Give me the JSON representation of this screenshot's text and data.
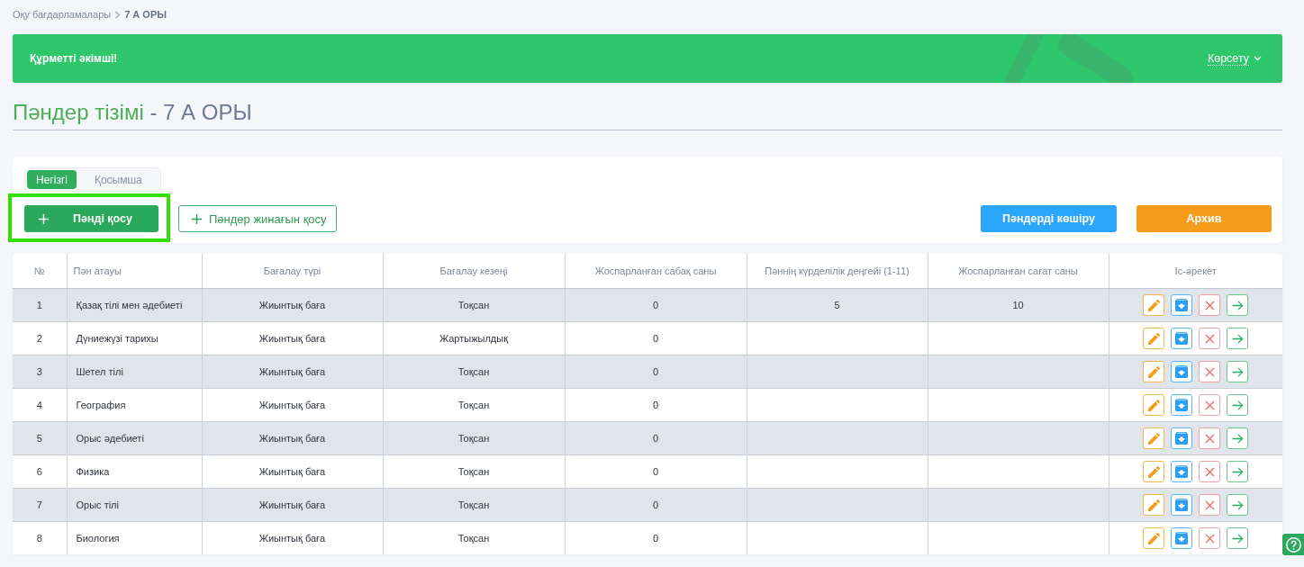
{
  "breadcrumb": [
    {
      "label": "Оқу бағдарламалары",
      "current": false
    },
    {
      "label": "7 А ОРЫ",
      "current": true
    }
  ],
  "banner": {
    "greeting": "Құрметті әкімші!",
    "toggle": "Көрсету"
  },
  "heading": {
    "title": "Пәндер тізімі",
    "class_name": "- 7 А ОРЫ"
  },
  "controls": {
    "tabs": [
      {
        "label": "Негізгі",
        "selected": true
      },
      {
        "label": "Қосымша",
        "selected": false
      }
    ],
    "left_buttons": [
      {
        "label": "Пәнді қосу",
        "kind": "primary",
        "highlighted": true
      },
      {
        "label": "Пәндер жинағын қосу",
        "kind": "outline",
        "highlighted": false
      }
    ],
    "right_buttons": [
      {
        "label": "Пәндерді көшіру",
        "kind": "info",
        "highlighted": false
      },
      {
        "label": "Архив",
        "kind": "warning",
        "highlighted": false
      }
    ]
  },
  "table": {
    "columns": [
      "№",
      "Пән атауы",
      "Бағалау түрі",
      "Бағалау кезеңі",
      "Жоспарланған сабақ саны",
      "Пәннің күрделілік деңгейі (1-11)",
      "Жоспарланған сағат саны",
      "Іс-әрекет"
    ],
    "rows": [
      {
        "number": "1",
        "subject": "Қазақ тілі мен әдебиеті",
        "assessment_type": "Жиынтық баға",
        "assessment_period": "Тоқсан",
        "planned_lessons": "0",
        "complexity_level": "5",
        "planned_hours": "10"
      },
      {
        "number": "2",
        "subject": "Дүниежүзі тарихы",
        "assessment_type": "Жиынтық баға",
        "assessment_period": "Жартыжылдық",
        "planned_lessons": "0"
      },
      {
        "number": "3",
        "subject": "Шетел тілі",
        "assessment_type": "Жиынтық баға",
        "assessment_period": "Тоқсан",
        "planned_lessons": "0"
      },
      {
        "number": "4",
        "subject": "География",
        "assessment_type": "Жиынтық баға",
        "assessment_period": "Тоқсан",
        "planned_lessons": "0"
      },
      {
        "number": "5",
        "subject": "Орыс әдебиеті",
        "assessment_type": "Жиынтық баға",
        "assessment_period": "Тоқсан",
        "planned_lessons": "0"
      },
      {
        "number": "6",
        "subject": "Физика",
        "assessment_type": "Жиынтық баға",
        "assessment_period": "Тоқсан",
        "planned_lessons": "0"
      },
      {
        "number": "7",
        "subject": "Орыс тілі",
        "assessment_type": "Жиынтық баға",
        "assessment_period": "Тоқсан",
        "planned_lessons": "0"
      },
      {
        "number": "8",
        "subject": "Биология",
        "assessment_type": "Жиынтық баға",
        "assessment_period": "Тоқсан",
        "planned_lessons": "0"
      }
    ]
  }
}
